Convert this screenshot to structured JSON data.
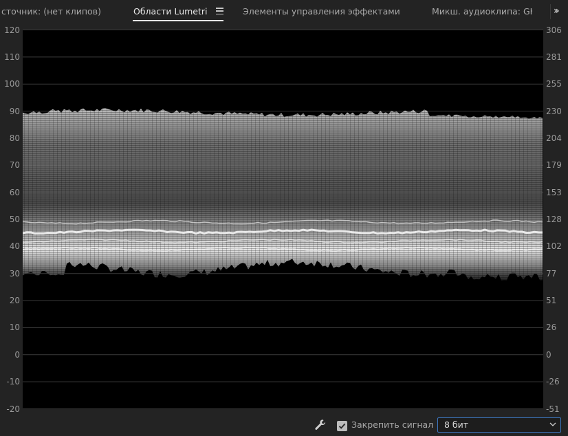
{
  "tabs": [
    {
      "label": "сточник: (нет клипов)",
      "active": false
    },
    {
      "label": "Области Lumetri",
      "active": true
    },
    {
      "label": "Элементы управления эффектами",
      "active": false
    },
    {
      "label": "Микш. аудиоклипа: GH",
      "active": false
    }
  ],
  "overflow_icon": "double-chevron-right-icon",
  "scope": {
    "type": "luma-waveform",
    "left_scale": [
      "120",
      "110",
      "100",
      "90",
      "80",
      "70",
      "60",
      "50",
      "40",
      "30",
      "20",
      "10",
      "0",
      "-10",
      "-20"
    ],
    "right_scale": [
      "306",
      "281",
      "255",
      "230",
      "204",
      "179",
      "153",
      "128",
      "102",
      "77",
      "51",
      "26",
      "0",
      "-26",
      "-51"
    ],
    "left_range": [
      -20,
      120
    ],
    "signal_range_ire": [
      28,
      91
    ],
    "bright_band_ire": [
      38,
      49
    ]
  },
  "toolbar": {
    "settings_icon": "wrench-icon",
    "clamp_checked": true,
    "clamp_label": "Закрепить сигнал",
    "bit_depth_value": "8 бит"
  },
  "colors": {
    "background": "#232323",
    "scope_background": "#000000",
    "accent": "#3e7bc8"
  }
}
